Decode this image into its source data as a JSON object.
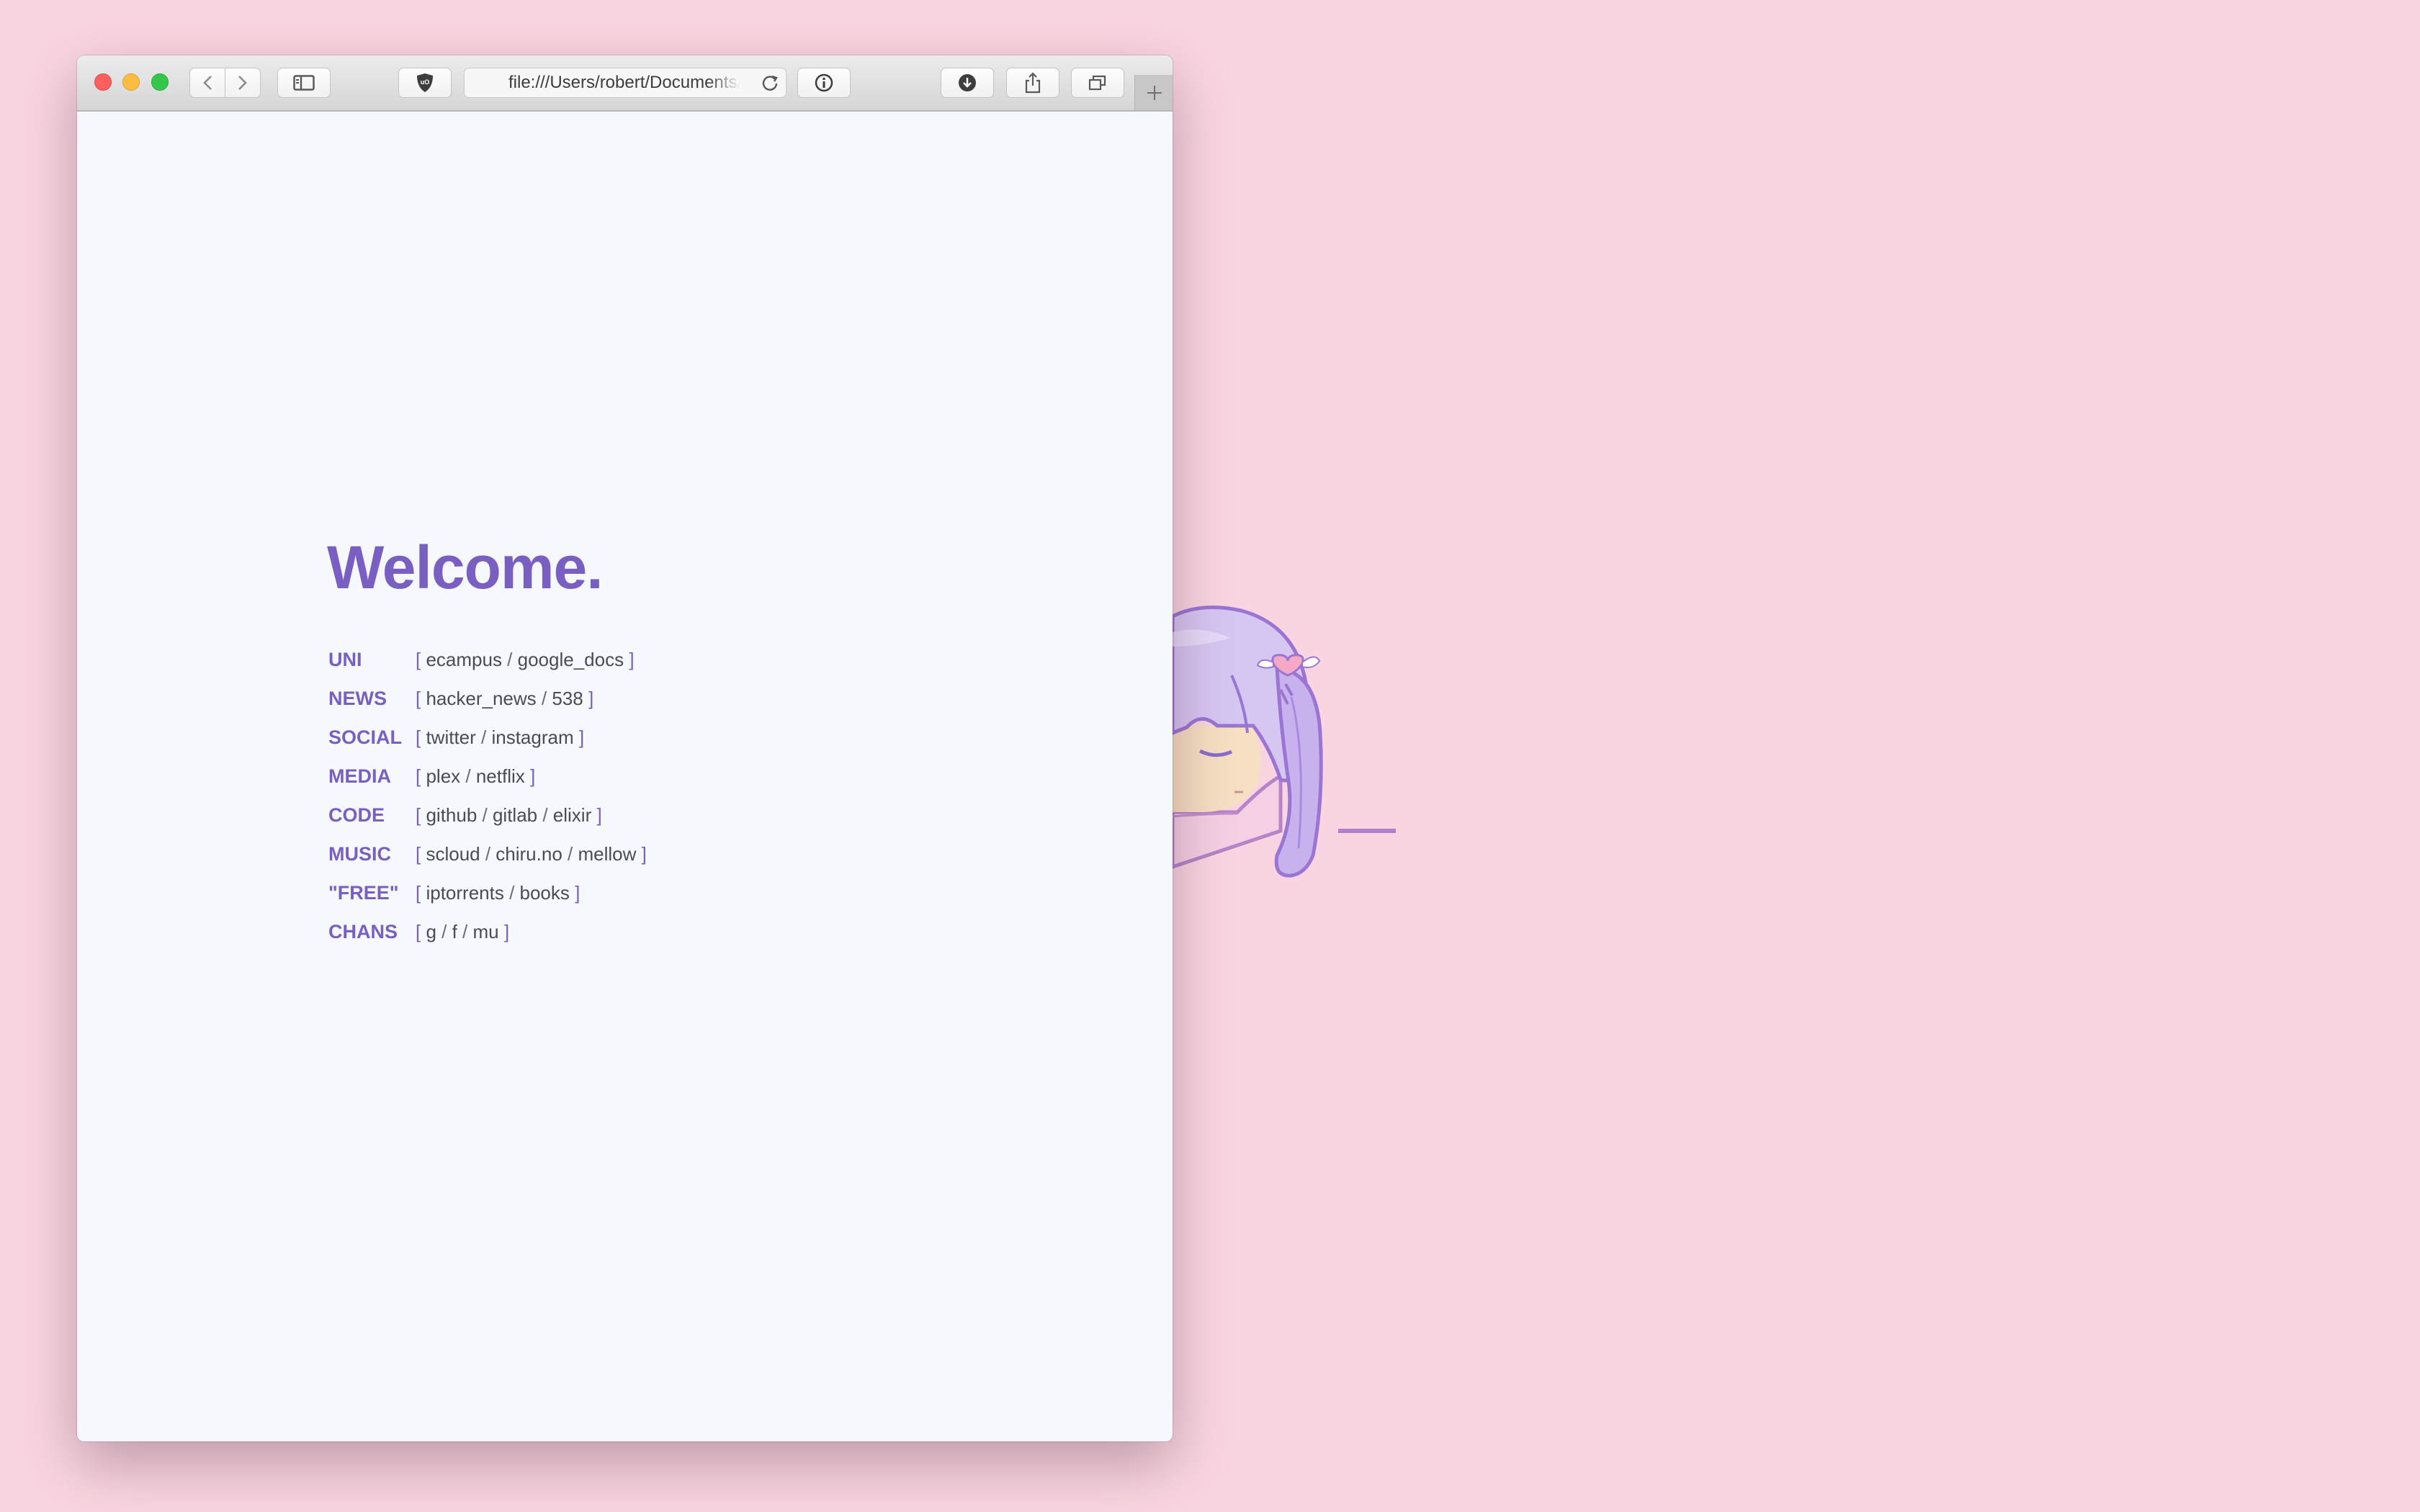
{
  "browser": {
    "address_url": "file:///Users/robert/Documents/startpage/index.html",
    "icons": [
      "close-button",
      "minimize-button",
      "zoom-button",
      "back-icon",
      "forward-icon",
      "sidebar-icon",
      "ublock-shield-icon",
      "reload-icon",
      "info-icon",
      "download-icon",
      "share-icon",
      "tabs-icon",
      "new-tab-plus-icon"
    ]
  },
  "page": {
    "heading": "Welcome.",
    "rows": [
      {
        "category": "UNI",
        "links": [
          "ecampus",
          "google_docs"
        ]
      },
      {
        "category": "NEWS",
        "links": [
          "hacker_news",
          "538"
        ]
      },
      {
        "category": "SOCIAL",
        "links": [
          "twitter",
          "instagram"
        ]
      },
      {
        "category": "MEDIA",
        "links": [
          "plex",
          "netflix"
        ]
      },
      {
        "category": "CODE",
        "links": [
          "github",
          "gitlab",
          "elixir"
        ]
      },
      {
        "category": "MUSIC",
        "links": [
          "scloud",
          "chiru.no",
          "mellow"
        ]
      },
      {
        "category": "\"FREE\"",
        "links": [
          "iptorrents",
          "books"
        ]
      },
      {
        "category": "CHANS",
        "links": [
          "g",
          "f",
          "mu"
        ]
      }
    ]
  },
  "colors": {
    "desktop_bg": "#f9d5e1",
    "page_bg": "#f5f8fd",
    "accent_purple": "#7a5fc3",
    "link_text": "#4b4b57"
  }
}
